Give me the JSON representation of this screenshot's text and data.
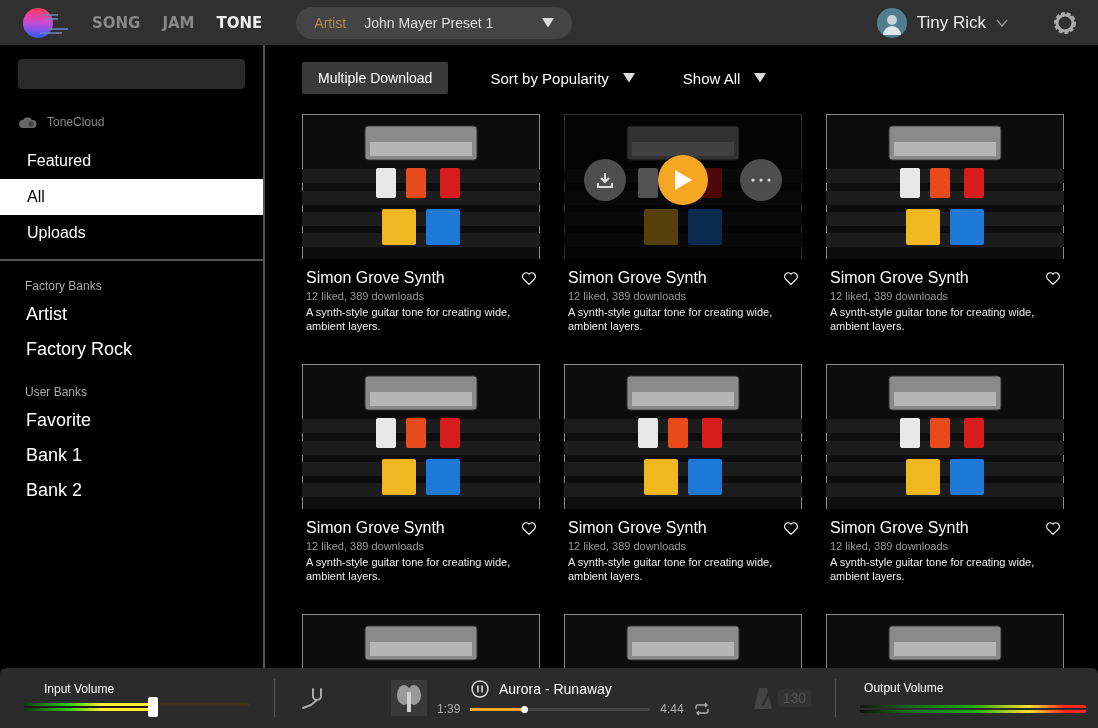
{
  "nav": {
    "tabs": [
      {
        "label": "SONG",
        "selected": false
      },
      {
        "label": "JAM",
        "selected": false
      },
      {
        "label": "TONE",
        "selected": true
      }
    ]
  },
  "preset": {
    "category": "Artist",
    "name": "John Mayer Preset 1"
  },
  "user": {
    "name": "Tiny Rick"
  },
  "sidebar": {
    "source": "ToneCloud",
    "items": [
      {
        "label": "Featured",
        "selected": false
      },
      {
        "label": "All",
        "selected": true
      },
      {
        "label": "Uploads",
        "selected": false
      }
    ],
    "sections": [
      {
        "title": "Factory Banks",
        "items": [
          {
            "label": "Artist",
            "selected": false
          },
          {
            "label": "Factory Rock",
            "selected": false
          }
        ]
      },
      {
        "title": "User Banks",
        "items": [
          {
            "label": "Favorite",
            "selected": false
          },
          {
            "label": "Bank 1",
            "selected": false
          },
          {
            "label": "Bank 2",
            "selected": false
          }
        ]
      }
    ]
  },
  "toolbar": {
    "button": "Multiple Download",
    "sort": "Sort by Popularity",
    "filter": "Show All"
  },
  "cards": [
    {
      "title": "Simon Grove Synth",
      "stats": "12 liked, 389 downloads",
      "description": "A synth-style guitar tone for creating wide, ambient layers.",
      "hovered": false
    },
    {
      "title": "Simon Grove Synth",
      "stats": "12 liked, 389 downloads",
      "description": "A synth-style guitar tone for creating wide, ambient layers.",
      "hovered": true
    },
    {
      "title": "Simon Grove Synth",
      "stats": "12 liked, 389 downloads",
      "description": "A synth-style guitar tone for creating wide, ambient layers.",
      "hovered": false
    },
    {
      "title": "Simon Grove Synth",
      "stats": "12 liked, 389 downloads",
      "description": "A synth-style guitar tone for creating wide, ambient layers.",
      "hovered": false
    },
    {
      "title": "Simon Grove Synth",
      "stats": "12 liked, 389 downloads",
      "description": "A synth-style guitar tone for creating wide, ambient layers.",
      "hovered": false
    },
    {
      "title": "Simon Grove Synth",
      "stats": "12 liked, 389 downloads",
      "description": "A synth-style guitar tone for creating wide, ambient layers.",
      "hovered": false
    },
    {
      "hovered": false
    },
    {
      "hovered": false
    },
    {
      "hovered": false
    }
  ],
  "player": {
    "input_volume": {
      "label": "Input Volume",
      "level": 0.57
    },
    "track": {
      "title": "Aurora - Runaway",
      "elapsed": "1:39",
      "total": "4:44",
      "level": 0.3,
      "playing": true
    },
    "tempo": {
      "value": "130",
      "disabled": true
    },
    "output_volume": {
      "label": "Output Volume",
      "level": 1.0
    }
  }
}
